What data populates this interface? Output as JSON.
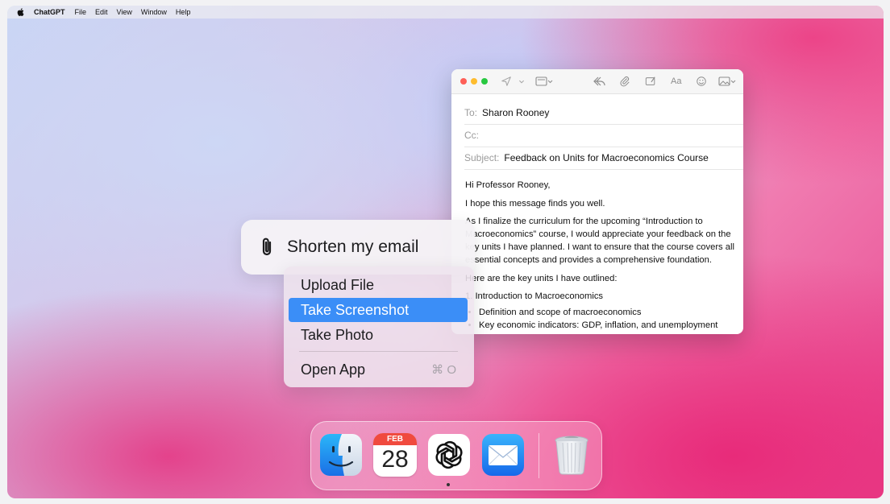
{
  "menubar": {
    "app": "ChatGPT",
    "items": [
      "File",
      "Edit",
      "View",
      "Window",
      "Help"
    ]
  },
  "prompt": {
    "text": "Shorten my email",
    "icon": "paperclip-icon"
  },
  "menu": {
    "items": [
      {
        "label": "Upload File"
      },
      {
        "label": "Take Screenshot",
        "selected": true
      },
      {
        "label": "Take Photo"
      },
      {
        "label": "Open App",
        "shortcut": "⌘ O"
      }
    ],
    "selected_color": "#3b8ef7"
  },
  "mail": {
    "to_label": "To:",
    "to": "Sharon Rooney",
    "cc_label": "Cc:",
    "cc": "",
    "subject_label": "Subject:",
    "subject": "Feedback on Units for Macroeconomics Course",
    "body": {
      "greeting": "Hi Professor Rooney,",
      "p1": "I hope this message finds you well.",
      "p2": "As I finalize the curriculum for the upcoming “Introduction to Macroeconomics” course, I would appreciate your feedback on the key units I have planned. I want to ensure that the course covers all essential concepts and provides a comprehensive foundation.",
      "p3": "Here are the key units I have outlined:",
      "unit1": "1. Introduction to Macroeconomics",
      "bullets": [
        "Definition and scope of macroeconomics",
        "Key economic indicators: GDP, inflation, and unemployment"
      ]
    }
  },
  "dock": {
    "calendar_month": "FEB",
    "calendar_day": "28",
    "apps": [
      "finder-icon",
      "calendar-icon",
      "chatgpt-icon",
      "mail-icon",
      "trash-icon"
    ]
  }
}
